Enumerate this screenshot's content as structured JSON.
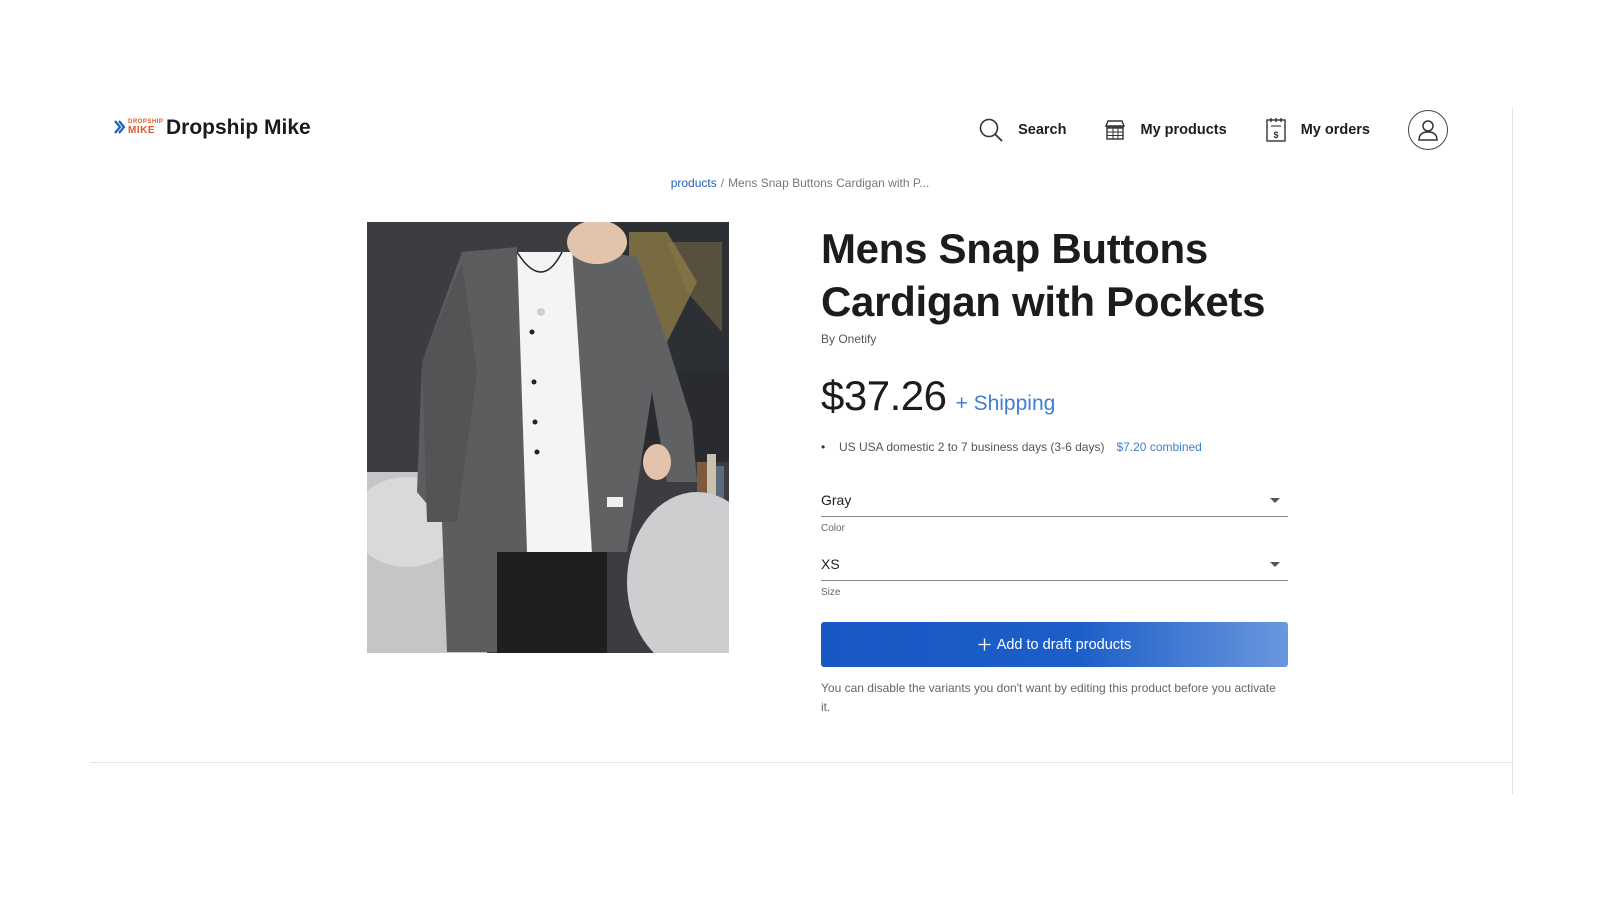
{
  "brand": {
    "name": "Dropship Mike",
    "logo_small_text": "DROPSHIP",
    "logo_big_text": "MIKE",
    "logo_color": "#e2582b",
    "logo_chevron_color": "#1f5fbf"
  },
  "nav": {
    "search_label": "Search",
    "products_label": "My products",
    "orders_label": "My orders"
  },
  "breadcrumb": {
    "root": "products",
    "separator": "/",
    "current": "Mens Snap Buttons Cardigan with P..."
  },
  "product": {
    "title": "Mens Snap Buttons Cardigan with Pockets",
    "by": "By Onetify",
    "price": "$37.26",
    "shipping_link": "+ Shipping",
    "shipping_detail": "US USA domestic 2 to 7 business days (3-6 days)",
    "shipping_combined": "$7.20 combined",
    "color_value": "Gray",
    "color_label": "Color",
    "size_value": "XS",
    "size_label": "Size",
    "add_button": "Add to draft products",
    "note": "You can disable the variants you don't want by editing this product before you activate it."
  },
  "colors": {
    "accent": "#1f5fbf",
    "link": "#3f7ed4",
    "button_start": "#1858c4",
    "button_end": "#6b97de"
  }
}
